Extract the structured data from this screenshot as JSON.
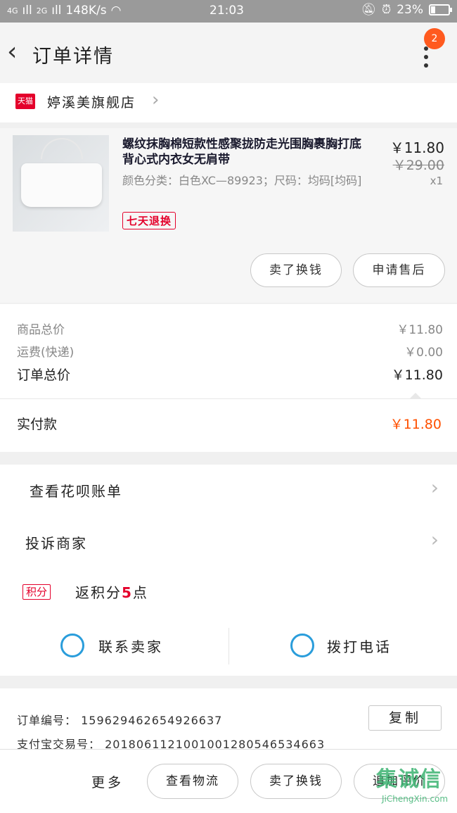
{
  "status_bar": {
    "signal": "4G",
    "signal2": "2G",
    "speed": "148K/s",
    "time": "21:03",
    "battery": "23%",
    "battery_level": 0.23
  },
  "nav": {
    "back_icon": "chevron-left-icon",
    "title": "订单详情",
    "badge_count": "2"
  },
  "store": {
    "badge": "天猫",
    "name": "婷溪美旗舰店"
  },
  "product": {
    "title": "螺纹抹胸棉短款性感聚拢防走光围胸裹胸打底背心式内衣女无肩带",
    "sku": "颜色分类：白色XC—89923；尺码：均码[均码]",
    "tag": "七天退换",
    "price": "￥11.80",
    "original_price": "￥29.00",
    "quantity": "x1",
    "buttons": [
      "卖了换钱",
      "申请售后"
    ]
  },
  "summary": {
    "goods_total_label": "商品总价",
    "goods_total_value": "￥11.80",
    "shipping_label": "运费(快递)",
    "shipping_value": "￥0.00",
    "order_total_label": "订单总价",
    "order_total_value": "￥11.80",
    "paid_label": "实付款",
    "paid_value": "￥11.80"
  },
  "actions": {
    "huabei": "查看花呗账单",
    "complain": "投诉商家",
    "points_badge": "积分",
    "points_prefix": "返积分",
    "points_num": "5",
    "points_suffix": "点",
    "contact_seller": "联系卖家",
    "call_phone": "拨打电话"
  },
  "order_info": {
    "order_no_label": "订单编号：",
    "order_no": "159629462654926637",
    "alipay_label": "支付宝交易号：",
    "alipay_no": "2018061121001001280546534663",
    "copy_label": "复制"
  },
  "bottom_bar": {
    "more": "更多",
    "buttons": [
      "查看物流",
      "卖了换钱",
      "追加评价"
    ]
  },
  "watermark": {
    "logo": "集诚信",
    "url": "JiChengXin.com"
  },
  "colors": {
    "accent_orange": "#ff5000",
    "tmall_red": "#e4002b",
    "contact_blue": "#2a9ddb"
  }
}
